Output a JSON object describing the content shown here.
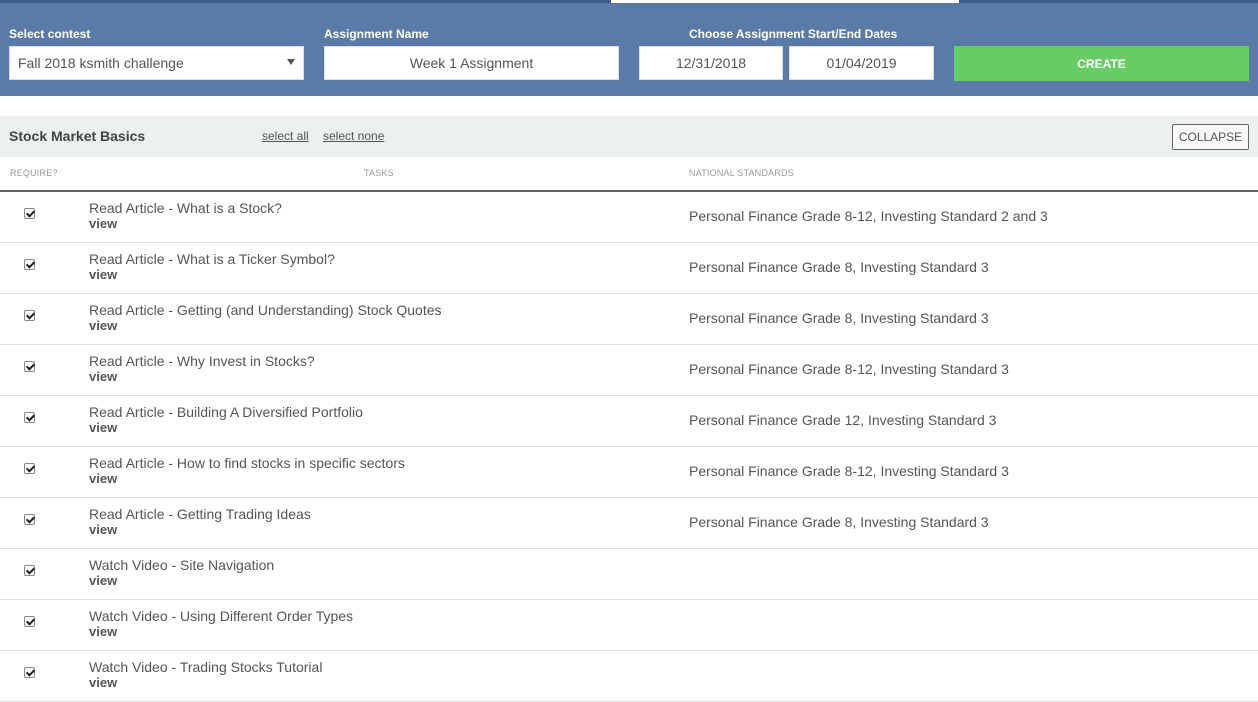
{
  "header": {
    "contest_label": "Select contest",
    "contest_value": "Fall 2018 ksmith challenge",
    "name_label": "Assignment Name",
    "name_value": "Week 1 Assignment",
    "dates_label": "Choose Assignment Start/End Dates",
    "start_date": "12/31/2018",
    "end_date": "01/04/2019",
    "create_label": "CREATE"
  },
  "section": {
    "title": "Stock Market Basics",
    "select_all": "select all",
    "select_none": "select none",
    "collapse": "COLLAPSE"
  },
  "columns": {
    "require": "REQUIRE?",
    "tasks": "TASKS",
    "standards": "NATIONAL STANDARDS"
  },
  "rows": [
    {
      "title": "Read Article - What is a Stock?",
      "view": "view",
      "standard": "Personal Finance Grade 8-12, Investing Standard 2 and 3",
      "checked": true
    },
    {
      "title": "Read Article - What is a Ticker Symbol?",
      "view": "view",
      "standard": "Personal Finance Grade 8, Investing Standard 3",
      "checked": true
    },
    {
      "title": "Read Article - Getting (and Understanding) Stock Quotes",
      "view": "view",
      "standard": "Personal Finance Grade 8, Investing Standard 3",
      "checked": true
    },
    {
      "title": "Read Article - Why Invest in Stocks?",
      "view": "view",
      "standard": "Personal Finance Grade 8-12, Investing Standard 3",
      "checked": true
    },
    {
      "title": "Read Article - Building A Diversified Portfolio",
      "view": "view",
      "standard": "Personal Finance Grade 12, Investing Standard 3",
      "checked": true
    },
    {
      "title": "Read Article - How to find stocks in specific sectors",
      "view": "view",
      "standard": "Personal Finance Grade 8-12, Investing Standard 3",
      "checked": true
    },
    {
      "title": "Read Article - Getting Trading Ideas",
      "view": "view",
      "standard": "Personal Finance Grade 8, Investing Standard 3",
      "checked": true
    },
    {
      "title": "Watch Video - Site Navigation",
      "view": "view",
      "standard": "",
      "checked": true
    },
    {
      "title": "Watch Video - Using Different Order Types",
      "view": "view",
      "standard": "",
      "checked": true
    },
    {
      "title": "Watch Video - Trading Stocks Tutorial",
      "view": "view",
      "standard": "",
      "checked": true
    }
  ],
  "colors": {
    "header_bg": "#5a7aa7",
    "create_bg": "#66cc66",
    "section_bg": "#edf0f0"
  }
}
